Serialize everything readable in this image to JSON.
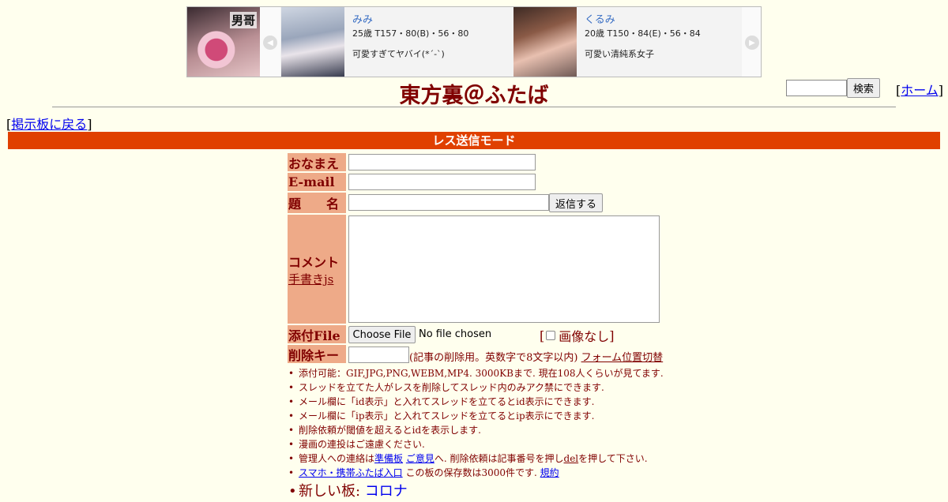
{
  "ad": {
    "logo_text": "男哥",
    "cards": [
      {
        "name": "みみ",
        "spec": "25歳 T157・80(B)・56・80",
        "catch": "可愛すぎてヤバイ(*´-`)"
      },
      {
        "name": "くるみ",
        "spec": "20歳 T150・84(E)・56・84",
        "catch": "可愛い清純系女子"
      }
    ]
  },
  "header": {
    "title": "東方裏＠ふたば",
    "search_button": "検索",
    "home_link": "ホーム",
    "back_link": "掲示板に戻る"
  },
  "mode_label": "レス送信モード",
  "form": {
    "name_label": "おなまえ",
    "email_label": "E-mail",
    "subject_label": "題　　名",
    "submit_button": "返信する",
    "comment_label": "コメント",
    "handwrite_link": "手書きjs",
    "file_label": "添付File",
    "file_button": "Choose File",
    "file_status": "No file chosen",
    "no_image_label": "画像なし",
    "delkey_label": "削除キー",
    "delkey_note": "(記事の削除用。英数字で8文字以内)",
    "form_position_link": "フォーム位置切替"
  },
  "notes": {
    "n1": "添付可能：GIF,JPG,PNG,WEBM,MP4. 3000KBまで. 現在108人くらいが見てます.",
    "n2": "スレッドを立てた人がレスを削除してスレッド内のみアク禁にできます.",
    "n3": "メール欄に「id表示」と入れてスレッドを立てるとid表示にできます.",
    "n4": "メール欄に「ip表示」と入れてスレッドを立てるとip表示にできます.",
    "n5": "削除依頼が閾値を超えるとidを表示します.",
    "n6": "漫画の連投はご遠慮ください.",
    "n7_prefix": "管理人への連絡は",
    "n7_link1": "準備板",
    "n7_link2": "ご意見",
    "n7_mid": "へ. 削除依頼は記事番号を押し",
    "n7_del": "del",
    "n7_suffix": "を押して下さい.",
    "n8_link": "スマホ・携帯ふたば入口",
    "n8_text": " この板の保存数は3000件です.",
    "n8_rules": "規約",
    "n9_prefix": "新しい板: ",
    "n9_link": "コロナ"
  }
}
